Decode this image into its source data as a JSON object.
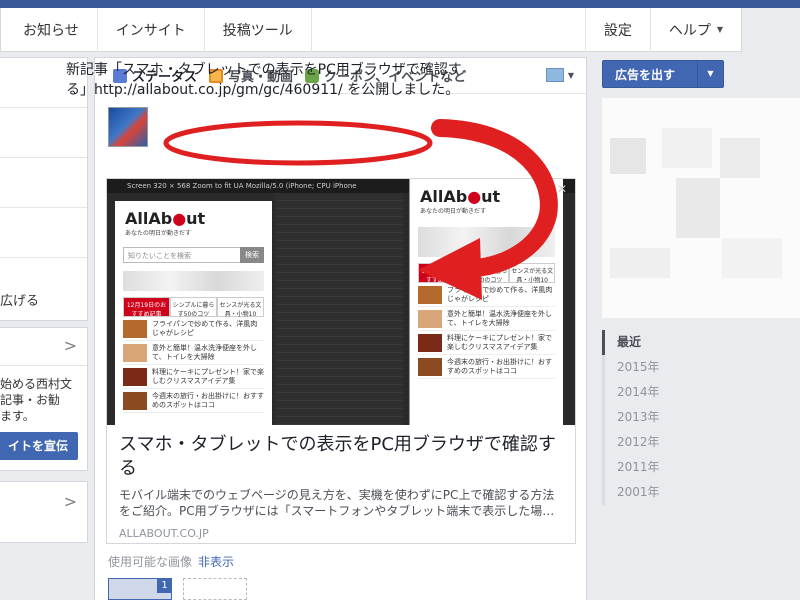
{
  "nav": {
    "items": [
      "お知らせ",
      "インサイト",
      "投稿ツール"
    ],
    "settings": "設定",
    "help": "ヘルプ"
  },
  "left": {
    "row_text": "広げる",
    "desc_lines": [
      "始める西村文",
      "記事・お勧",
      "ます。"
    ],
    "promote": "イトを宣伝"
  },
  "composer": {
    "tabs": [
      "ステータス",
      "写真・動画",
      "クーポン、イベントなど"
    ],
    "post_text": "新記事「スマホ・タブレットでの表示をPC用ブラウザで確認する」http://allabout.co.jp/gm/gc/460911/ を公開しました。",
    "card": {
      "title": "スマホ・タブレットでの表示をPC用ブラウザで確認する",
      "description": "モバイル端末でのウェブページの見え方を、実機を使わずにPC上で確認する方法をご紹介。PC用ブラウザには「スマートフォンやタブレット端末で表示した場…",
      "domain": "ALLABOUT.CO.JP"
    },
    "available_images": "使用可能な画像",
    "hide_link": "非表示",
    "image_count": "1"
  },
  "screenshot": {
    "toolbar": "Screen 320 × 568   Zoom to fit   UA Mozilla/5.0 (iPhone; CPU iPhone",
    "logo_a": "AllAb",
    "logo_o": "●",
    "logo_b": "ut",
    "logo_sub": "あなたの明日が動きだす",
    "search_placeholder": "知りたいことを検索",
    "search_button": "検索",
    "cats": [
      "12月19日のおすすめ記事",
      "シンプルに暮らす50のコツ",
      "センスが光る文具・小物10"
    ],
    "articles": [
      "フライパンで炒めて作る、洋風肉じゃがレシピ",
      "意外と簡単！温水洗浄便座を外して、トイレを大掃除",
      "料理にケーキにプレゼント！家で楽しむクリスマスアイデア集",
      "今週末の旅行・お出掛けに！おすすめのスポットはココ"
    ]
  },
  "right": {
    "ad_button": "広告を出す",
    "years": [
      "最近",
      "2015年",
      "2014年",
      "2013年",
      "2012年",
      "2011年",
      "2001年"
    ]
  },
  "annotation": {
    "ellipse_color": "#e02020",
    "arrow_color": "#e02020"
  }
}
